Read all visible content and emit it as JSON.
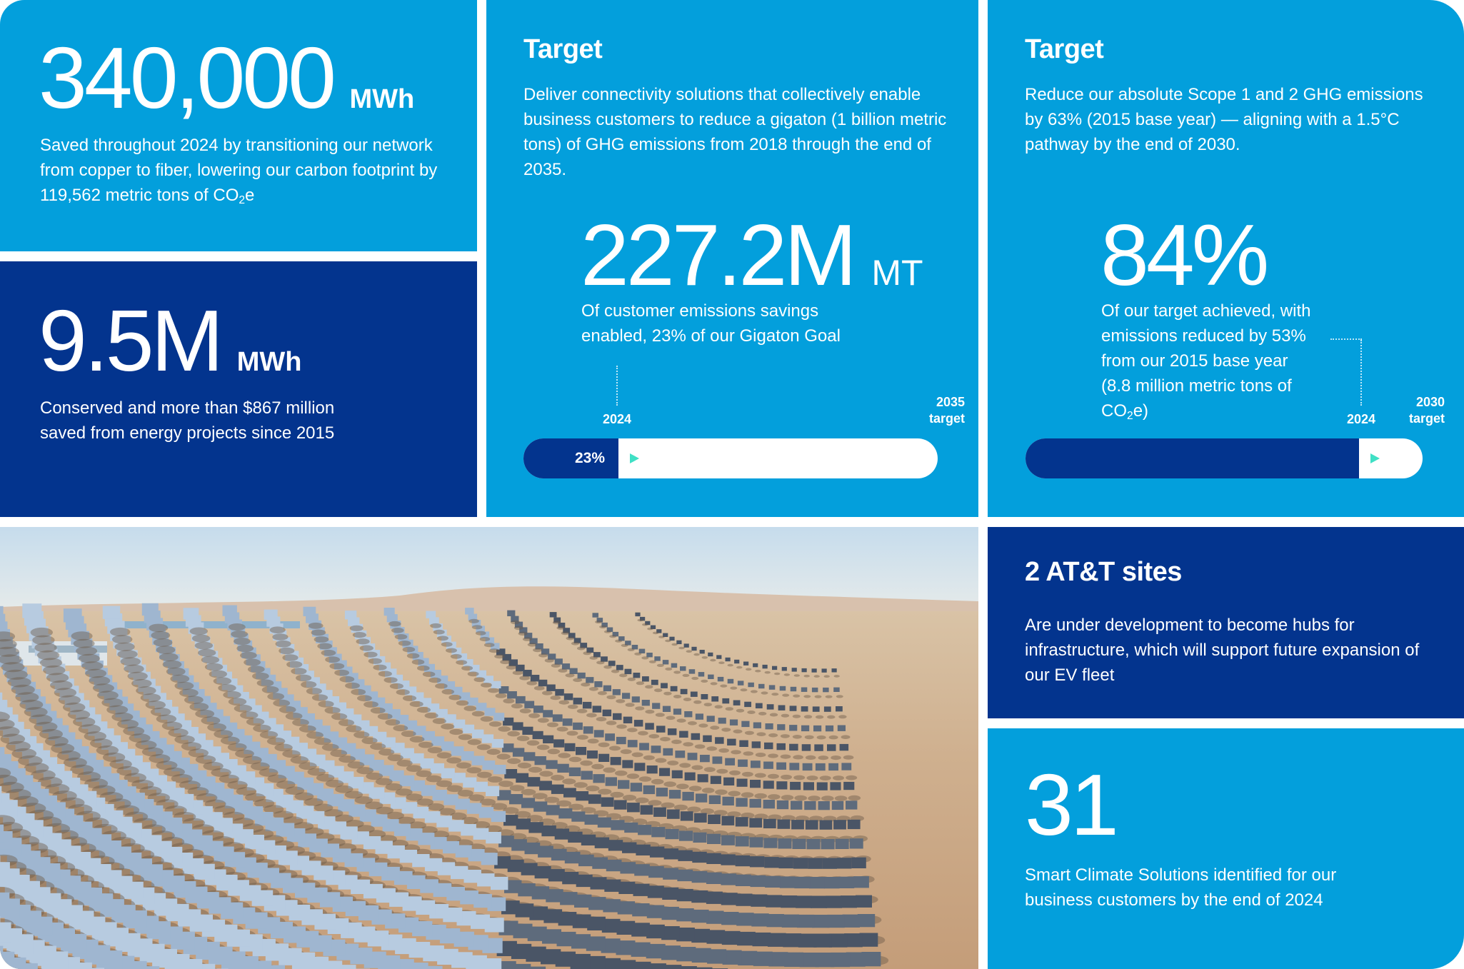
{
  "card_fiber": {
    "value": "340,000",
    "unit": "MWh",
    "desc_pre": "Saved throughout 2024 by transitioning our network from copper to fiber, lowering our carbon footprint by 119,562 metric tons of CO",
    "desc_sub": "2",
    "desc_post": "e"
  },
  "card_energy": {
    "value": "9.5M",
    "unit": "MWh",
    "desc": "Conserved and more than $867 million saved from energy projects since 2015"
  },
  "card_gigaton": {
    "heading": "Target",
    "desc": "Deliver connectivity solutions that collectively enable business customers to reduce a gigaton (1 billion metric tons) of GHG emissions from 2018 through the end of 2035.",
    "value": "227.2M",
    "unit": "MT",
    "sub": "Of customer emissions savings enabled, 23% of our Gigaton Goal",
    "marker_current": "2024",
    "marker_target_year": "2035",
    "marker_target_label": "target",
    "progress": 0.23,
    "progress_label": "23%"
  },
  "card_scope": {
    "heading": "Target",
    "desc": "Reduce our absolute Scope 1 and 2 GHG emissions by 63% (2015 base year) — aligning with a 1.5°C pathway by the end of 2030.",
    "value": "84%",
    "sub_pre": "Of our target achieved, with emissions reduced by 53% from our 2015 base year (8.8 million metric tons of CO",
    "sub_sub": "2",
    "sub_post": "e)",
    "marker_current": "2024",
    "marker_target_year": "2030",
    "marker_target_label": "target",
    "progress": 0.84
  },
  "card_sites": {
    "heading": "2 AT&T sites",
    "desc": "Are under development to become hubs for infrastructure, which will support future expansion of our EV fleet"
  },
  "card_solutions": {
    "value": "31",
    "desc": "Smart Climate Solutions identified for our business customers by the end of 2024"
  },
  "colors": {
    "light_blue": "#039fdc",
    "dark_blue": "#03348e",
    "accent_arrow": "#3fe0c5",
    "white": "#ffffff"
  }
}
